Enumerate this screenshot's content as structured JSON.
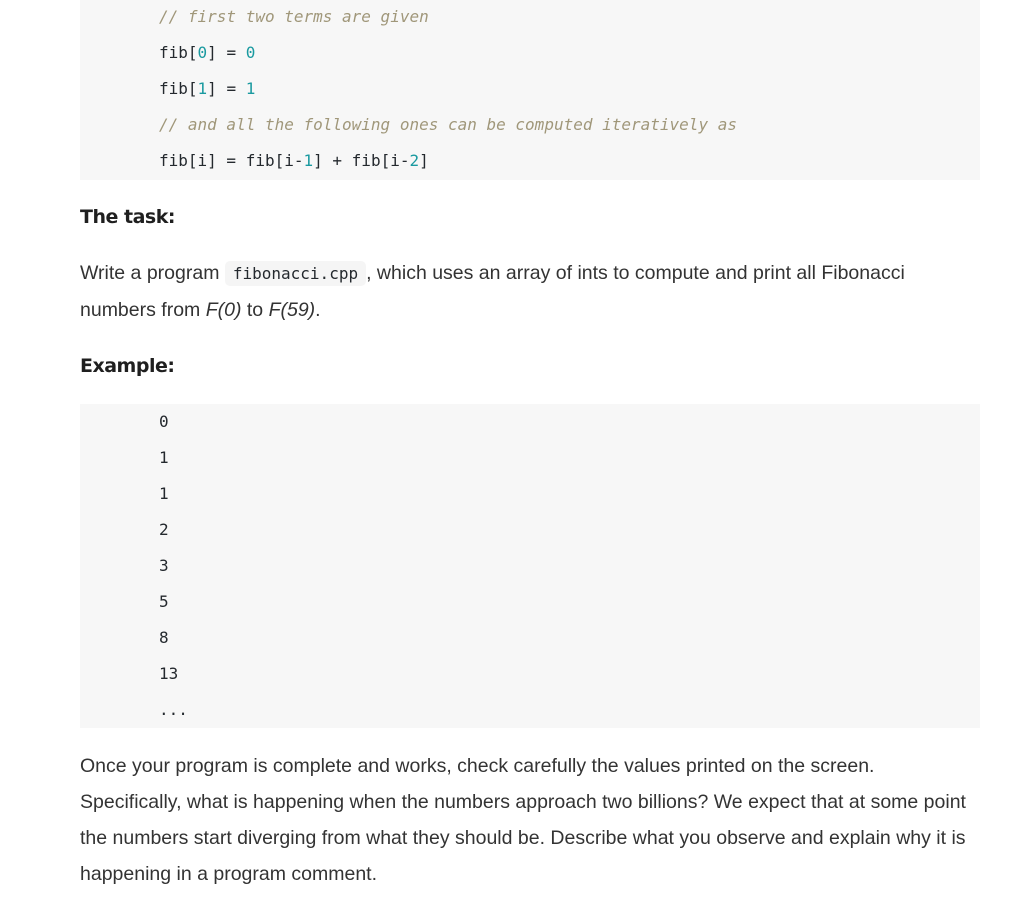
{
  "code_top": {
    "lines": {
      "l0": {
        "comment": "// first two terms are given"
      },
      "l1": {
        "a": "fib[",
        "n1": "0",
        "b": "] = ",
        "n2": "0"
      },
      "l2": {
        "a": "fib[",
        "n1": "1",
        "b": "] = ",
        "n2": "1"
      },
      "l3": {
        "comment": "// and all the following ones can be computed iteratively as"
      },
      "l4": {
        "a": "fib[i] = fib[i-",
        "n1": "1",
        "b": "] + fib[i-",
        "n2": "2",
        "c": "]"
      }
    }
  },
  "task_heading": "The task:",
  "task_paragraph": {
    "before_code": "Write a program ",
    "code": "fibonacci.cpp",
    "after_code": ", which uses an array of ints to compute and print all Fibonacci numbers from ",
    "f0": "F(0)",
    "to": " to ",
    "f59": "F(59)",
    "end": "."
  },
  "example_heading": "Example:",
  "example_output": [
    "0",
    "1",
    "1",
    "2",
    "3",
    "5",
    "8",
    "13",
    "..."
  ],
  "final_paragraph": "Once your program is complete and works, check carefully the values printed on the screen. Specifically, what is happening when the numbers approach two billions? We expect that at some point the numbers start diverging from what they should be. Describe what you observe and explain why it is happening in a program comment."
}
